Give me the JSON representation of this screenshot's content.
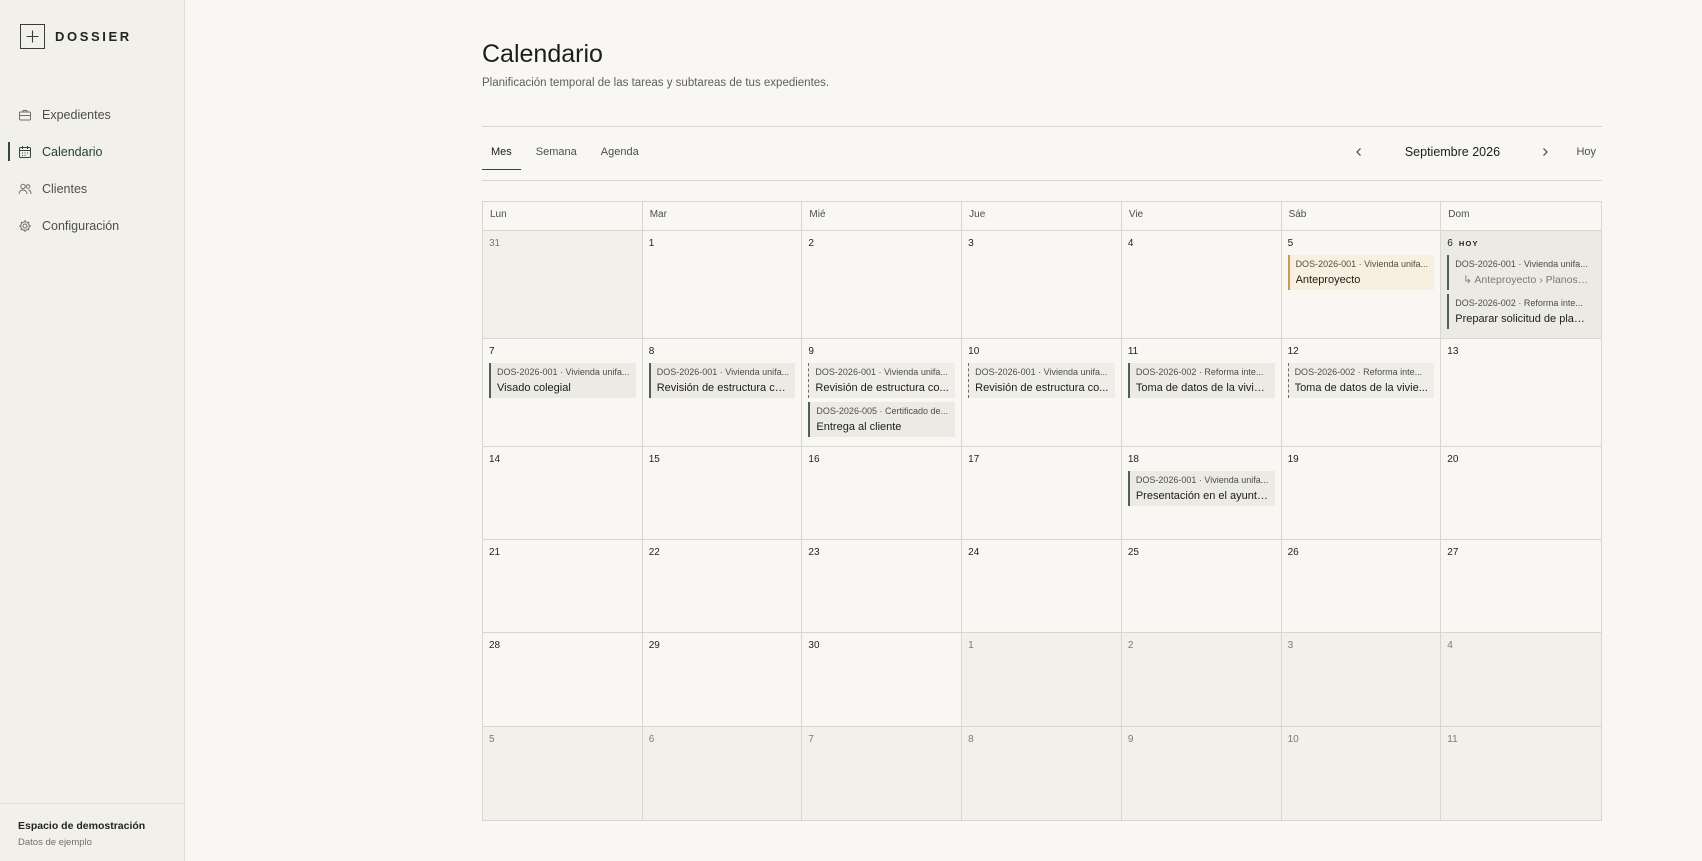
{
  "sidebar": {
    "logo_text": "DOSSIER",
    "items": [
      {
        "label": "Expedientes",
        "icon": "briefcase-icon",
        "active": false
      },
      {
        "label": "Calendario",
        "icon": "calendar-icon",
        "active": true
      },
      {
        "label": "Clientes",
        "icon": "users-icon",
        "active": false
      },
      {
        "label": "Configuración",
        "icon": "gear-icon",
        "active": false
      }
    ],
    "footer": {
      "workspace": "Espacio de demostración",
      "subtitle": "Datos de ejemplo"
    }
  },
  "header": {
    "title": "Calendario",
    "subtitle": "Planificación temporal de las tareas y subtareas de tus expedientes."
  },
  "tabs": [
    {
      "label": "Mes",
      "active": true
    },
    {
      "label": "Semana",
      "active": false
    },
    {
      "label": "Agenda",
      "active": false
    }
  ],
  "month_nav": {
    "label": "Septiembre 2026",
    "today_label": "Hoy"
  },
  "colors": {
    "accent": "#2f4a3d",
    "warm_event": "#f8efe1",
    "today_bg": "#ebebe3"
  },
  "calendar": {
    "weekdays": [
      "Lun",
      "Mar",
      "Mié",
      "Jue",
      "Vie",
      "Sáb",
      "Dom"
    ],
    "today_badge": "HOY",
    "weeks": [
      {
        "days": [
          {
            "num": "31",
            "out": true,
            "events": []
          },
          {
            "num": "1",
            "events": []
          },
          {
            "num": "2",
            "events": []
          },
          {
            "num": "3",
            "events": []
          },
          {
            "num": "4",
            "events": []
          },
          {
            "num": "5",
            "events": [
              {
                "code": "DOS-2026-001 · Vivienda unifa...",
                "title": "Anteproyecto",
                "style": "warm"
              }
            ]
          },
          {
            "num": "6",
            "today": true,
            "events": [
              {
                "code": "DOS-2026-001 · Vivienda unifa...",
                "path": "↳ Anteproyecto › Planos ...",
                "style": "subtask"
              },
              {
                "code": "DOS-2026-002 · Reforma inte...",
                "title": "Preparar solicitud de plan...",
                "style": "solid"
              }
            ]
          }
        ]
      },
      {
        "days": [
          {
            "num": "7",
            "events": [
              {
                "code": "DOS-2026-001 · Vivienda unifa...",
                "title": "Visado colegial",
                "style": "solid"
              }
            ]
          },
          {
            "num": "8",
            "events": [
              {
                "code": "DOS-2026-001 · Vivienda unifa...",
                "title": "Revisión de estructura co...",
                "style": "solid"
              }
            ]
          },
          {
            "num": "9",
            "events": [
              {
                "code": "DOS-2026-001 · Vivienda unifa...",
                "title": "Revisión de estructura co...",
                "style": "dashed"
              },
              {
                "code": "DOS-2026-005 · Certificado de...",
                "title": "Entrega al cliente",
                "style": "solid"
              }
            ]
          },
          {
            "num": "10",
            "events": [
              {
                "code": "DOS-2026-001 · Vivienda unifa...",
                "title": "Revisión de estructura co...",
                "style": "dashed"
              }
            ]
          },
          {
            "num": "11",
            "events": [
              {
                "code": "DOS-2026-002 · Reforma inte...",
                "title": "Toma de datos de la vivie...",
                "style": "solid"
              }
            ]
          },
          {
            "num": "12",
            "events": [
              {
                "code": "DOS-2026-002 · Reforma inte...",
                "title": "Toma de datos de la vivie...",
                "style": "dashed"
              }
            ]
          },
          {
            "num": "13",
            "events": []
          }
        ]
      },
      {
        "days": [
          {
            "num": "14",
            "events": []
          },
          {
            "num": "15",
            "events": []
          },
          {
            "num": "16",
            "events": []
          },
          {
            "num": "17",
            "events": []
          },
          {
            "num": "18",
            "events": [
              {
                "code": "DOS-2026-001 · Vivienda unifa...",
                "title": "Presentación en el ayunta...",
                "style": "solid"
              }
            ]
          },
          {
            "num": "19",
            "events": []
          },
          {
            "num": "20",
            "events": []
          }
        ]
      },
      {
        "days": [
          {
            "num": "21",
            "events": []
          },
          {
            "num": "22",
            "events": []
          },
          {
            "num": "23",
            "events": []
          },
          {
            "num": "24",
            "events": []
          },
          {
            "num": "25",
            "events": []
          },
          {
            "num": "26",
            "events": []
          },
          {
            "num": "27",
            "events": []
          }
        ]
      },
      {
        "days": [
          {
            "num": "28",
            "events": []
          },
          {
            "num": "29",
            "events": []
          },
          {
            "num": "30",
            "events": []
          },
          {
            "num": "1",
            "out": true,
            "events": []
          },
          {
            "num": "2",
            "out": true,
            "events": []
          },
          {
            "num": "3",
            "out": true,
            "events": []
          },
          {
            "num": "4",
            "out": true,
            "events": []
          }
        ]
      },
      {
        "days": [
          {
            "num": "5",
            "out": true,
            "events": []
          },
          {
            "num": "6",
            "out": true,
            "events": []
          },
          {
            "num": "7",
            "out": true,
            "events": []
          },
          {
            "num": "8",
            "out": true,
            "events": []
          },
          {
            "num": "9",
            "out": true,
            "events": []
          },
          {
            "num": "10",
            "out": true,
            "events": []
          },
          {
            "num": "11",
            "out": true,
            "events": []
          }
        ]
      }
    ]
  }
}
